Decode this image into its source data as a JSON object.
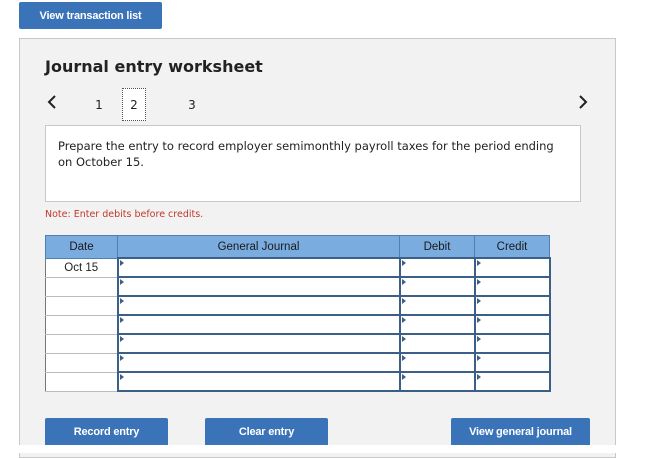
{
  "toolbar": {
    "view_transactions_label": "View transaction list"
  },
  "worksheet": {
    "title": "Journal entry worksheet",
    "pages": [
      "1",
      "2",
      "3"
    ],
    "active_page": "2",
    "prompt": "Prepare the entry to record employer semimonthly payroll taxes for the period ending on October 15.",
    "note": "Note: Enter debits before credits."
  },
  "journal": {
    "headers": {
      "date": "Date",
      "account": "General Journal",
      "debit": "Debit",
      "credit": "Credit"
    },
    "rows": [
      {
        "date": "Oct 15",
        "account": "",
        "debit": "",
        "credit": ""
      },
      {
        "date": "",
        "account": "",
        "debit": "",
        "credit": ""
      },
      {
        "date": "",
        "account": "",
        "debit": "",
        "credit": ""
      },
      {
        "date": "",
        "account": "",
        "debit": "",
        "credit": ""
      },
      {
        "date": "",
        "account": "",
        "debit": "",
        "credit": ""
      },
      {
        "date": "",
        "account": "",
        "debit": "",
        "credit": ""
      },
      {
        "date": "",
        "account": "",
        "debit": "",
        "credit": ""
      }
    ]
  },
  "actions": {
    "record_label": "Record entry",
    "clear_label": "Clear entry",
    "view_journal_label": "View general journal"
  },
  "colors": {
    "button": "#3a73b8",
    "header": "#7aace0",
    "note": "#c0392b",
    "panel": "#f2f2f2"
  },
  "icons": {
    "prev": "chevron-left-icon",
    "next": "chevron-right-icon"
  }
}
